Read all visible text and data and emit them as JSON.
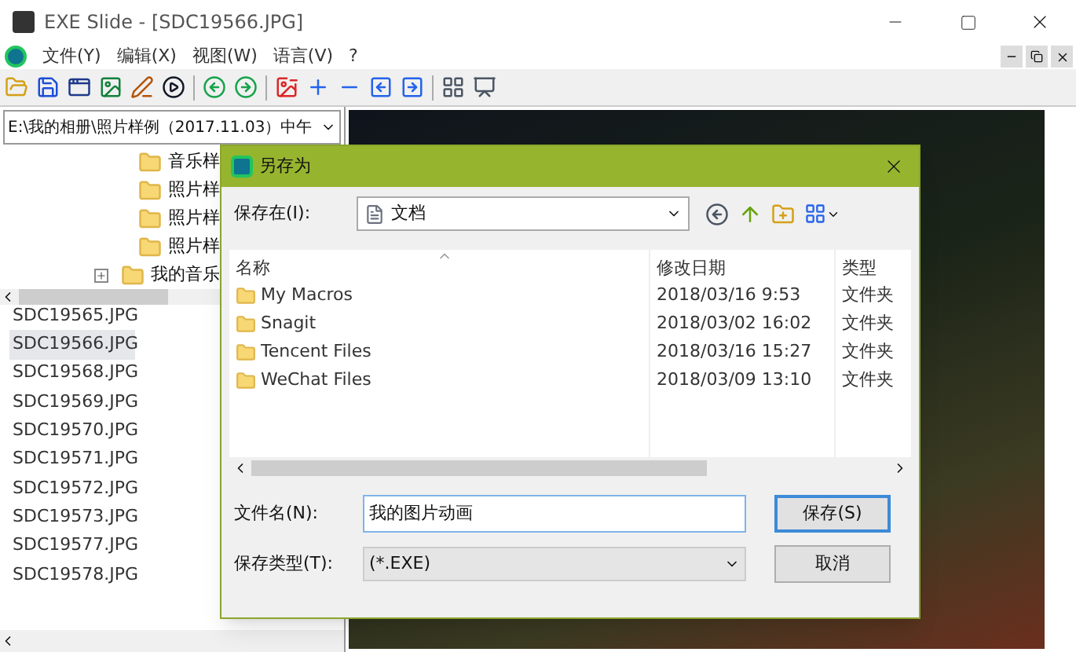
{
  "window": {
    "title": "EXE Slide - [SDC19566.JPG]"
  },
  "menu": [
    "文件(Y)",
    "编辑(X)",
    "视图(W)",
    "语言(V)",
    "?"
  ],
  "path_combo": {
    "value": "E:\\我的相册\\照片样例（2017.11.03）中午"
  },
  "tree": [
    {
      "label": "音乐样"
    },
    {
      "label": "照片样"
    },
    {
      "label": "照片样"
    },
    {
      "label": "照片样"
    },
    {
      "label": "我的音乐",
      "expanded": false
    }
  ],
  "files": [
    {
      "name": "SDC19565.JPG",
      "selected": false
    },
    {
      "name": "SDC19566.JPG",
      "selected": true
    },
    {
      "name": "SDC19568.JPG",
      "selected": false
    },
    {
      "name": "SDC19569.JPG",
      "selected": false
    },
    {
      "name": "SDC19570.JPG",
      "selected": false
    },
    {
      "name": "SDC19571.JPG",
      "selected": false
    },
    {
      "name": "SDC19572.JPG",
      "selected": false
    },
    {
      "name": "SDC19573.JPG",
      "selected": false
    },
    {
      "name": "SDC19577.JPG",
      "selected": false
    },
    {
      "name": "SDC19578.JPG",
      "selected": false
    }
  ],
  "dialog": {
    "title": "另存为",
    "save_in_label": "保存在(I):",
    "save_in_value": "文档",
    "columns": [
      "名称",
      "修改日期",
      "类型"
    ],
    "rows": [
      {
        "name": "My Macros",
        "date": "2018/03/16 9:53",
        "type": "文件夹"
      },
      {
        "name": "Snagit",
        "date": "2018/03/02 16:02",
        "type": "文件夹"
      },
      {
        "name": "Tencent Files",
        "date": "2018/03/16 15:27",
        "type": "文件夹"
      },
      {
        "name": "WeChat Files",
        "date": "2018/03/09 13:10",
        "type": "文件夹"
      }
    ],
    "filename_label": "文件名(N):",
    "filename_value": "我的图片动画",
    "filetype_label": "保存类型(T):",
    "filetype_value": "(*.EXE)",
    "save_button": "保存(S)",
    "cancel_button": "取消"
  }
}
